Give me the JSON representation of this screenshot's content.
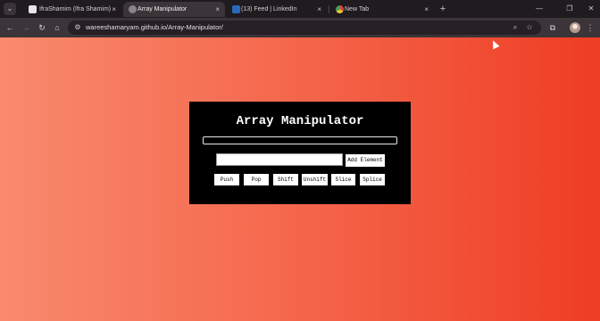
{
  "browser": {
    "tabs": [
      {
        "title": "IfraShamim (Ifra Shamim)",
        "icon": "github-icon",
        "active": false
      },
      {
        "title": "Array Manipulator",
        "icon": "globe-icon",
        "active": true
      },
      {
        "title": "(13) Feed | LinkedIn",
        "icon": "linkedin-icon",
        "active": false
      },
      {
        "title": "New Tab",
        "icon": "chrome-icon",
        "active": false
      }
    ],
    "close_glyph": "×",
    "new_tab_glyph": "+",
    "address": "wareeshamaryam.github.io/Array-Manipulator/"
  },
  "app": {
    "title": "Array Manipulator",
    "input_value": "",
    "add_button": "Add Element",
    "buttons": [
      "Push",
      "Pop",
      "Shift",
      "Unshift",
      "Slice",
      "Splice"
    ]
  },
  "colors": {
    "page_gradient_start": "#f98a6e",
    "page_gradient_end": "#ee3d24",
    "card_background": "#000000"
  }
}
